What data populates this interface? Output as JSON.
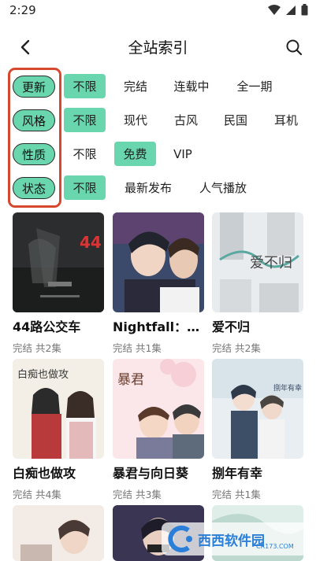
{
  "status": {
    "time": "2:29"
  },
  "header": {
    "title": "全站索引"
  },
  "filters": [
    {
      "category": "更新",
      "options": [
        "不限",
        "完结",
        "连载中",
        "全一期"
      ],
      "selected": 0
    },
    {
      "category": "风格",
      "options": [
        "不限",
        "现代",
        "古风",
        "民国",
        "耳机"
      ],
      "selected": 0
    },
    {
      "category": "性质",
      "options": [
        "不限",
        "免费",
        "VIP"
      ],
      "selected": 1
    },
    {
      "category": "状态",
      "options": [
        "不限",
        "最新发布",
        "人气播放"
      ],
      "selected": 0
    }
  ],
  "items": [
    {
      "title": "44路公交车",
      "meta": "完结 共2集",
      "cover_text": "44"
    },
    {
      "title": "Nightfall：…",
      "meta": "完结 共1集",
      "cover_text": ""
    },
    {
      "title": "爱不归",
      "meta": "完结 共2集",
      "cover_text": "爱不归"
    },
    {
      "title": "白痴也做攻",
      "meta": "完结 共4集",
      "cover_text": "白痴也做攻"
    },
    {
      "title": "暴君与向日葵",
      "meta": "完结 共3集",
      "cover_text": "暴君"
    },
    {
      "title": "捌年有幸",
      "meta": "完结 共1集",
      "cover_text": "捌年有幸"
    }
  ],
  "watermark": {
    "text": "西西软件园",
    "sub": "CR173.COM"
  },
  "colors": {
    "accent": "#69d6ad",
    "highlight_box": "#d6492f"
  }
}
